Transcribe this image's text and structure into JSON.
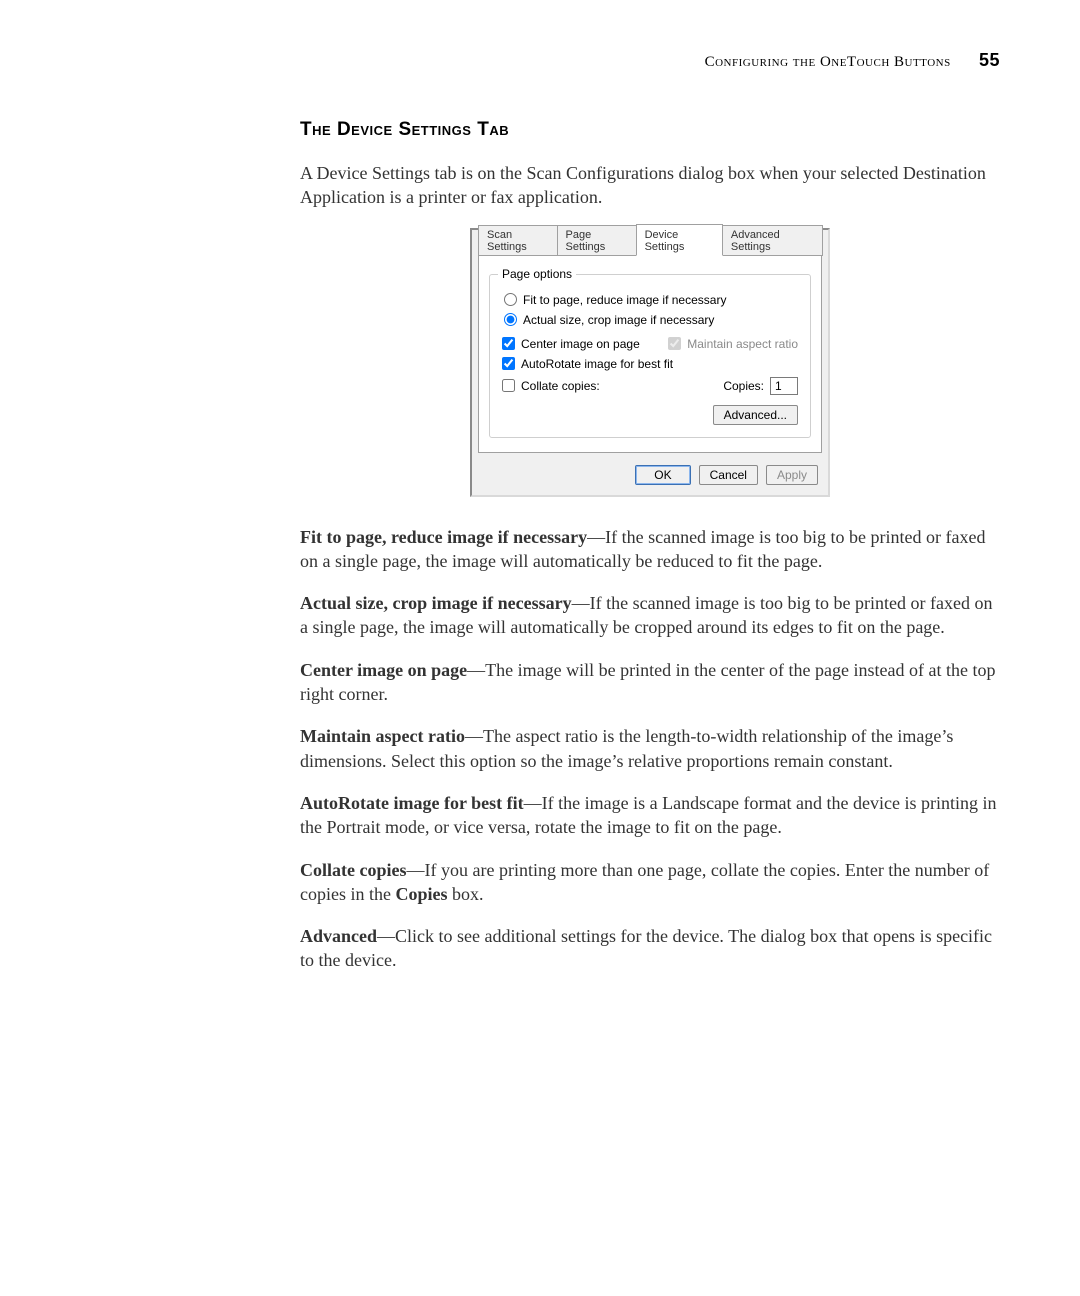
{
  "header": {
    "chapter": "Configuring the OneTouch Buttons",
    "page_number": "55"
  },
  "section_title": "The Device Settings Tab",
  "intro": "A Device Settings tab is on the Scan Configurations dialog box when your selected Destination Application is a printer or fax application.",
  "dialog": {
    "tabs": [
      "Scan Settings",
      "Page Settings",
      "Device Settings",
      "Advanced Settings"
    ],
    "active_tab_index": 2,
    "group_title": "Page options",
    "radio_fit": "Fit to page, reduce image if necessary",
    "radio_actual": "Actual size, crop image if necessary",
    "chk_center": "Center image on page",
    "chk_aspect": "Maintain aspect ratio",
    "chk_autorotate": "AutoRotate image for best fit",
    "chk_collate": "Collate copies:",
    "copies_label": "Copies:",
    "copies_value": "1",
    "advanced_btn": "Advanced...",
    "ok": "OK",
    "cancel": "Cancel",
    "apply": "Apply"
  },
  "descriptions": {
    "fit": {
      "title": "Fit to page, reduce image if necessary",
      "text": "—If the scanned image is too big to be printed or faxed on a single page, the image will automatically be reduced to fit the page."
    },
    "actual": {
      "title": "Actual size, crop image if necessary",
      "text": "—If the scanned image is too big to be printed or faxed on a single page, the image will automatically be cropped around its edges to fit on the page."
    },
    "center": {
      "title": "Center image on page",
      "text": "—The image will be printed in the center of the page instead of at the top right corner."
    },
    "aspect": {
      "title": "Maintain aspect ratio",
      "text": "—The aspect ratio is the length-to-width relationship of the image’s dimensions. Select this option so the image’s relative proportions remain constant."
    },
    "autorotate": {
      "title": "AutoRotate image for best fit",
      "text": "—If the image is a Landscape format and the device is printing in the Portrait mode, or vice versa, rotate the image to fit on the page."
    },
    "collate_a": "Collate copies",
    "collate_b": "—If you are printing more than one page, collate the copies. Enter the number of copies in the ",
    "collate_c": "Copies",
    "collate_d": " box.",
    "advanced": {
      "title": "Advanced",
      "text": "—Click to see additional settings for the device. The dialog box that opens is specific to the device."
    }
  }
}
